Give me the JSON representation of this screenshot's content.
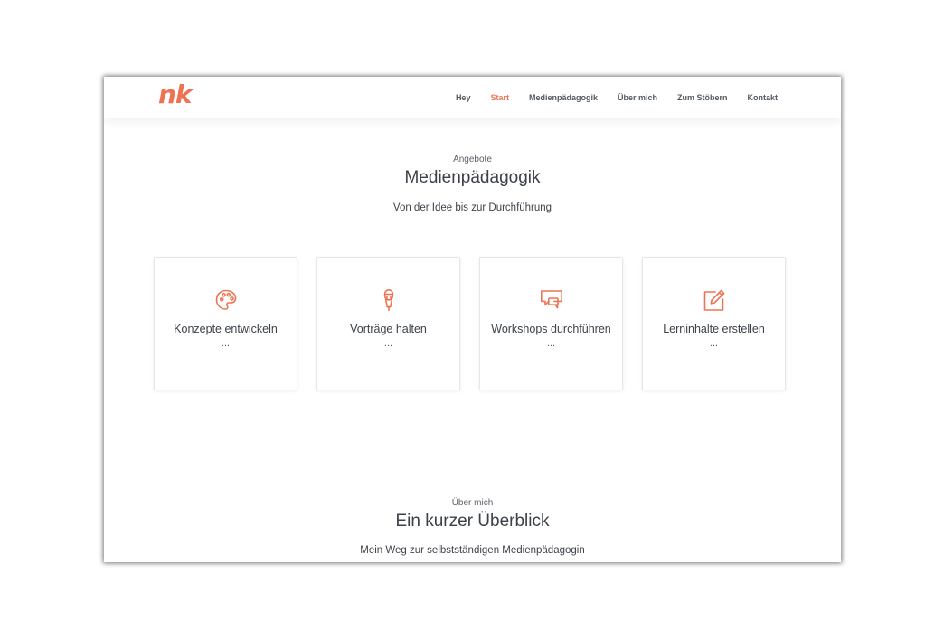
{
  "header": {
    "logo": "nk",
    "nav": [
      {
        "label": "Hey",
        "active": false
      },
      {
        "label": "Start",
        "active": true
      },
      {
        "label": "Medienpädagogik",
        "active": false
      },
      {
        "label": "Über mich",
        "active": false
      },
      {
        "label": "Zum Stöbern",
        "active": false
      },
      {
        "label": "Kontakt",
        "active": false
      }
    ]
  },
  "services": {
    "eyebrow": "Angebote",
    "title": "Medienpädagogik",
    "subtitle": "Von der Idee bis zur Durchführung",
    "cards": [
      {
        "icon": "palette-icon",
        "title": "Konzepte entwickeln",
        "desc": "..."
      },
      {
        "icon": "microphone-icon",
        "title": "Vorträge halten",
        "desc": "..."
      },
      {
        "icon": "chat-bubbles-icon",
        "title": "Workshops durchführen",
        "desc": "..."
      },
      {
        "icon": "edit-icon",
        "title": "Lerninhalte erstellen",
        "desc": "..."
      }
    ]
  },
  "about": {
    "eyebrow": "Über mich",
    "title": "Ein kurzer Überblick",
    "subtitle": "Mein Weg zur selbstständigen Medienpädagogin"
  },
  "colors": {
    "accent": "#ed7354",
    "text": "#3c4148",
    "border": "#e4e6ea"
  }
}
